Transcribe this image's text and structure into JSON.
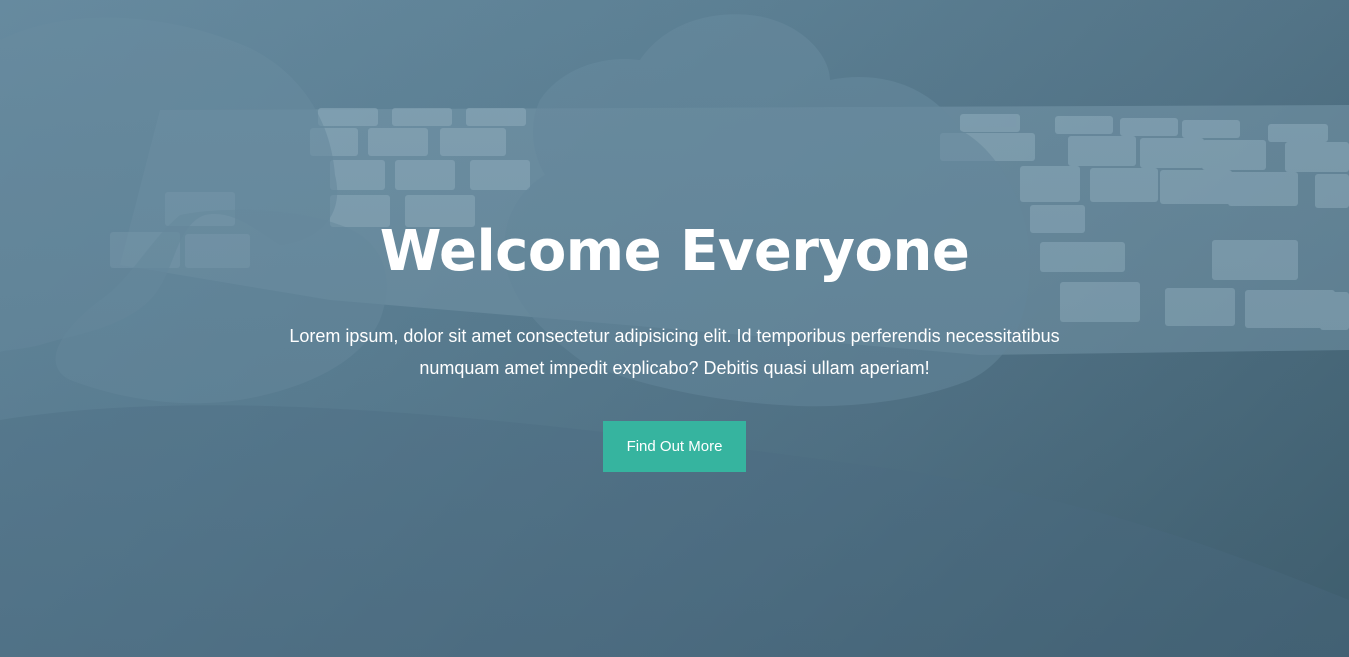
{
  "hero": {
    "title": "Welcome Everyone",
    "text": "Lorem ipsum, dolor sit amet consectetur adipisicing elit. Id temporibus perferendis necessitatibus numquam amet impedit explicabo? Debitis quasi ullam aperiam!",
    "button_label": "Find Out More"
  },
  "colors": {
    "overlay": "#5c7f93",
    "button": "#36b49f",
    "text": "#ffffff"
  }
}
